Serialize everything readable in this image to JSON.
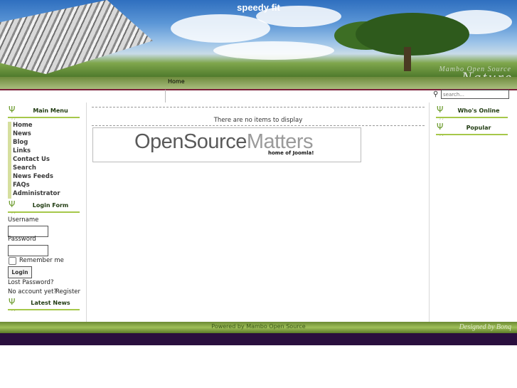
{
  "header": {
    "site_title": "speedy fit",
    "brand_top": "Mambo Open Source",
    "brand_big": "Nature"
  },
  "topnav": {
    "home": "Home"
  },
  "search": {
    "placeholder": "search..."
  },
  "main_menu": {
    "title": "Main Menu",
    "items": [
      "Home",
      "News",
      "Blog",
      "Links",
      "Contact Us",
      "Search",
      "News Feeds",
      "FAQs",
      "Administrator"
    ]
  },
  "login": {
    "title": "Login Form",
    "username_label": "Username",
    "password_label": "Password",
    "remember_label": "Remember me",
    "button": "Login",
    "lost_password": "Lost Password?",
    "no_account": "No account yet?",
    "register": "Register"
  },
  "latest_news": {
    "title": "Latest News"
  },
  "main": {
    "empty_text": "There are no items to display",
    "banner_part1": "OpenSource",
    "banner_part2": "Matters",
    "banner_sub": "home of Joomla!"
  },
  "right": {
    "whos_online": "Who's Online",
    "popular": "Popular"
  },
  "footer": {
    "powered_by": "Powered by Mambo Open Source",
    "designed_by": "Designed by Bonq"
  },
  "colors": {
    "accent_green": "#a6c84a",
    "nav_border": "#7a1f3a",
    "bottom_bar": "#2a0f3e"
  }
}
